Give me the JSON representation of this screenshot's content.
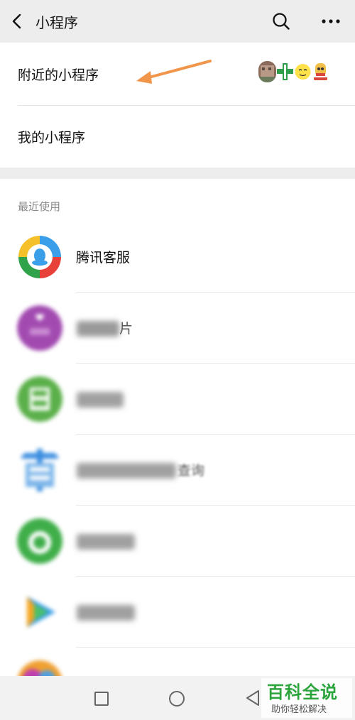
{
  "header": {
    "title": "小程序",
    "back_icon": "chevron-left-icon",
    "search_icon": "search-icon",
    "more_icon": "more-dots-icon"
  },
  "section1": {
    "nearby_label": "附近的小程序",
    "mine_label": "我的小程序",
    "annotation_color": "#f0954a"
  },
  "recent": {
    "label": "最近使用",
    "items": [
      {
        "name": "腾讯客服",
        "icon": "tencent-support-icon"
      },
      {
        "name": "",
        "visible_suffix": "片",
        "icon": "purple-heart-icon",
        "blurred": true
      },
      {
        "name": "",
        "icon": "green-grid-icon",
        "blurred": true
      },
      {
        "name": "",
        "visible_suffix": "查询",
        "icon": "blue-query-icon",
        "blurred": true
      },
      {
        "name": "",
        "icon": "green-wechat-icon",
        "blurred": true
      },
      {
        "name": "",
        "icon": "video-play-icon",
        "blurred": true
      },
      {
        "name": "",
        "icon": "colorful-icon",
        "blurred": true
      }
    ]
  },
  "watermark": {
    "title": "百科全说",
    "subtitle": "助你轻松解决"
  },
  "colors": {
    "background": "#ededed",
    "accent_green": "#2aa43b"
  }
}
